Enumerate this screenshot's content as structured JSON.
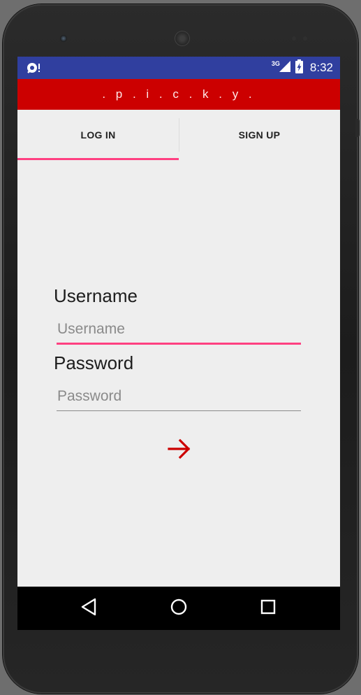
{
  "status_bar": {
    "network_type": "3G",
    "time": "8:32",
    "left_icon": "data-saver-icon",
    "signal_icon": "cell-signal-icon",
    "battery_icon": "battery-charging-icon"
  },
  "app_bar": {
    "title": ". p . i . c . k . y ."
  },
  "tabs": [
    {
      "label": "LOG IN",
      "selected": true
    },
    {
      "label": "SIGN UP",
      "selected": false
    }
  ],
  "form": {
    "username_label": "Username",
    "username_placeholder": "Username",
    "username_value": "",
    "password_label": "Password",
    "password_placeholder": "Password",
    "password_value": "",
    "submit_icon": "arrow-right-icon"
  },
  "nav_bar": {
    "back_icon": "back-triangle-icon",
    "home_icon": "home-circle-icon",
    "recents_icon": "recents-square-icon"
  },
  "colors": {
    "status_bar": "#303f9f",
    "app_bar": "#cc0000",
    "accent": "#ff4081",
    "submit_arrow": "#cc0000",
    "background": "#eeeeee"
  }
}
